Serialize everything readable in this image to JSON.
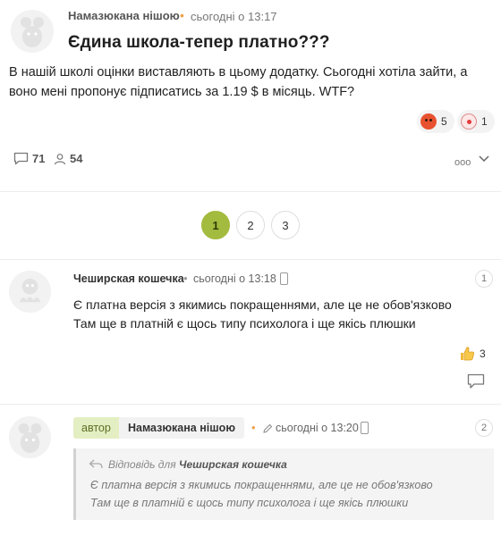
{
  "post": {
    "author": "Намазюкана нішою",
    "online_dot": "•",
    "time": "сьогодні о 13:17",
    "title": "Єдина школа-тепер платно???",
    "body": "В нашій школі оцінки виставляють в цьому додатку. Сьогодні хотіла зайти, а воно мені пропонує підписатись за 1.19 $ в місяць. WTF?",
    "reactions": [
      {
        "icon": "angry-face-icon",
        "count": "5"
      },
      {
        "icon": "clown-face-icon",
        "count": "1"
      }
    ],
    "comments_count": "71",
    "followers_count": "54",
    "more_label": "ooo"
  },
  "pagination": {
    "pages": [
      "1",
      "2",
      "3"
    ],
    "active": "1"
  },
  "comments": [
    {
      "author": "Чеширская кошечка",
      "separator": "•",
      "time": "сьогодні о 13:18",
      "number": "1",
      "text_lines": [
        "Є платна версія з якимись покращеннями, але це не обов'язково",
        "Там ще в платній є щось типу психолога і ще якісь плюшки"
      ],
      "likes": "3"
    },
    {
      "badge": "автор",
      "author": "Намазюкана нішою",
      "separator": "•",
      "time": "сьогодні о 13:20",
      "number": "2",
      "quote": {
        "prefix": "Відповідь для",
        "target": "Чеширская кошечка",
        "lines": [
          "Є платна версія з якимись покращеннями, але це не обов'язково",
          "Там ще в платній є щось типу психолога і ще якісь плюшки"
        ]
      }
    }
  ],
  "colors": {
    "accent": "#a3bb3e",
    "online": "#f0a04b",
    "author_badge_bg": "#e3efc2"
  }
}
